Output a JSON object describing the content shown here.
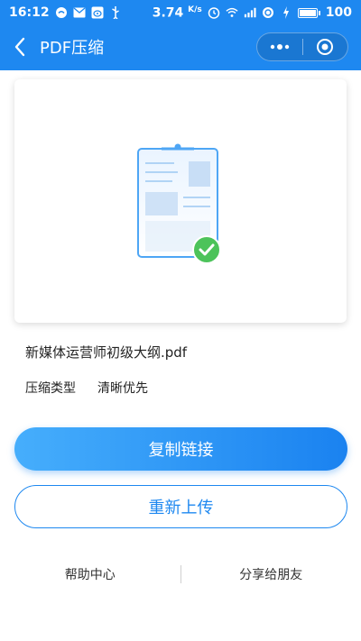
{
  "status_bar": {
    "time": "16:12",
    "speed_value": "3.74",
    "speed_unit": "K/s",
    "battery": "100"
  },
  "nav": {
    "title": "PDF压缩"
  },
  "file": {
    "name": "新媒体运营师初级大纲.pdf",
    "compress_type_label": "压缩类型",
    "compress_type_value": "清晰优先"
  },
  "actions": {
    "copy_link": "复制链接",
    "reupload": "重新上传"
  },
  "footer": {
    "help": "帮助中心",
    "share": "分享给朋友"
  },
  "colors": {
    "brand": "#1e88f0",
    "success": "#4cc35a"
  }
}
